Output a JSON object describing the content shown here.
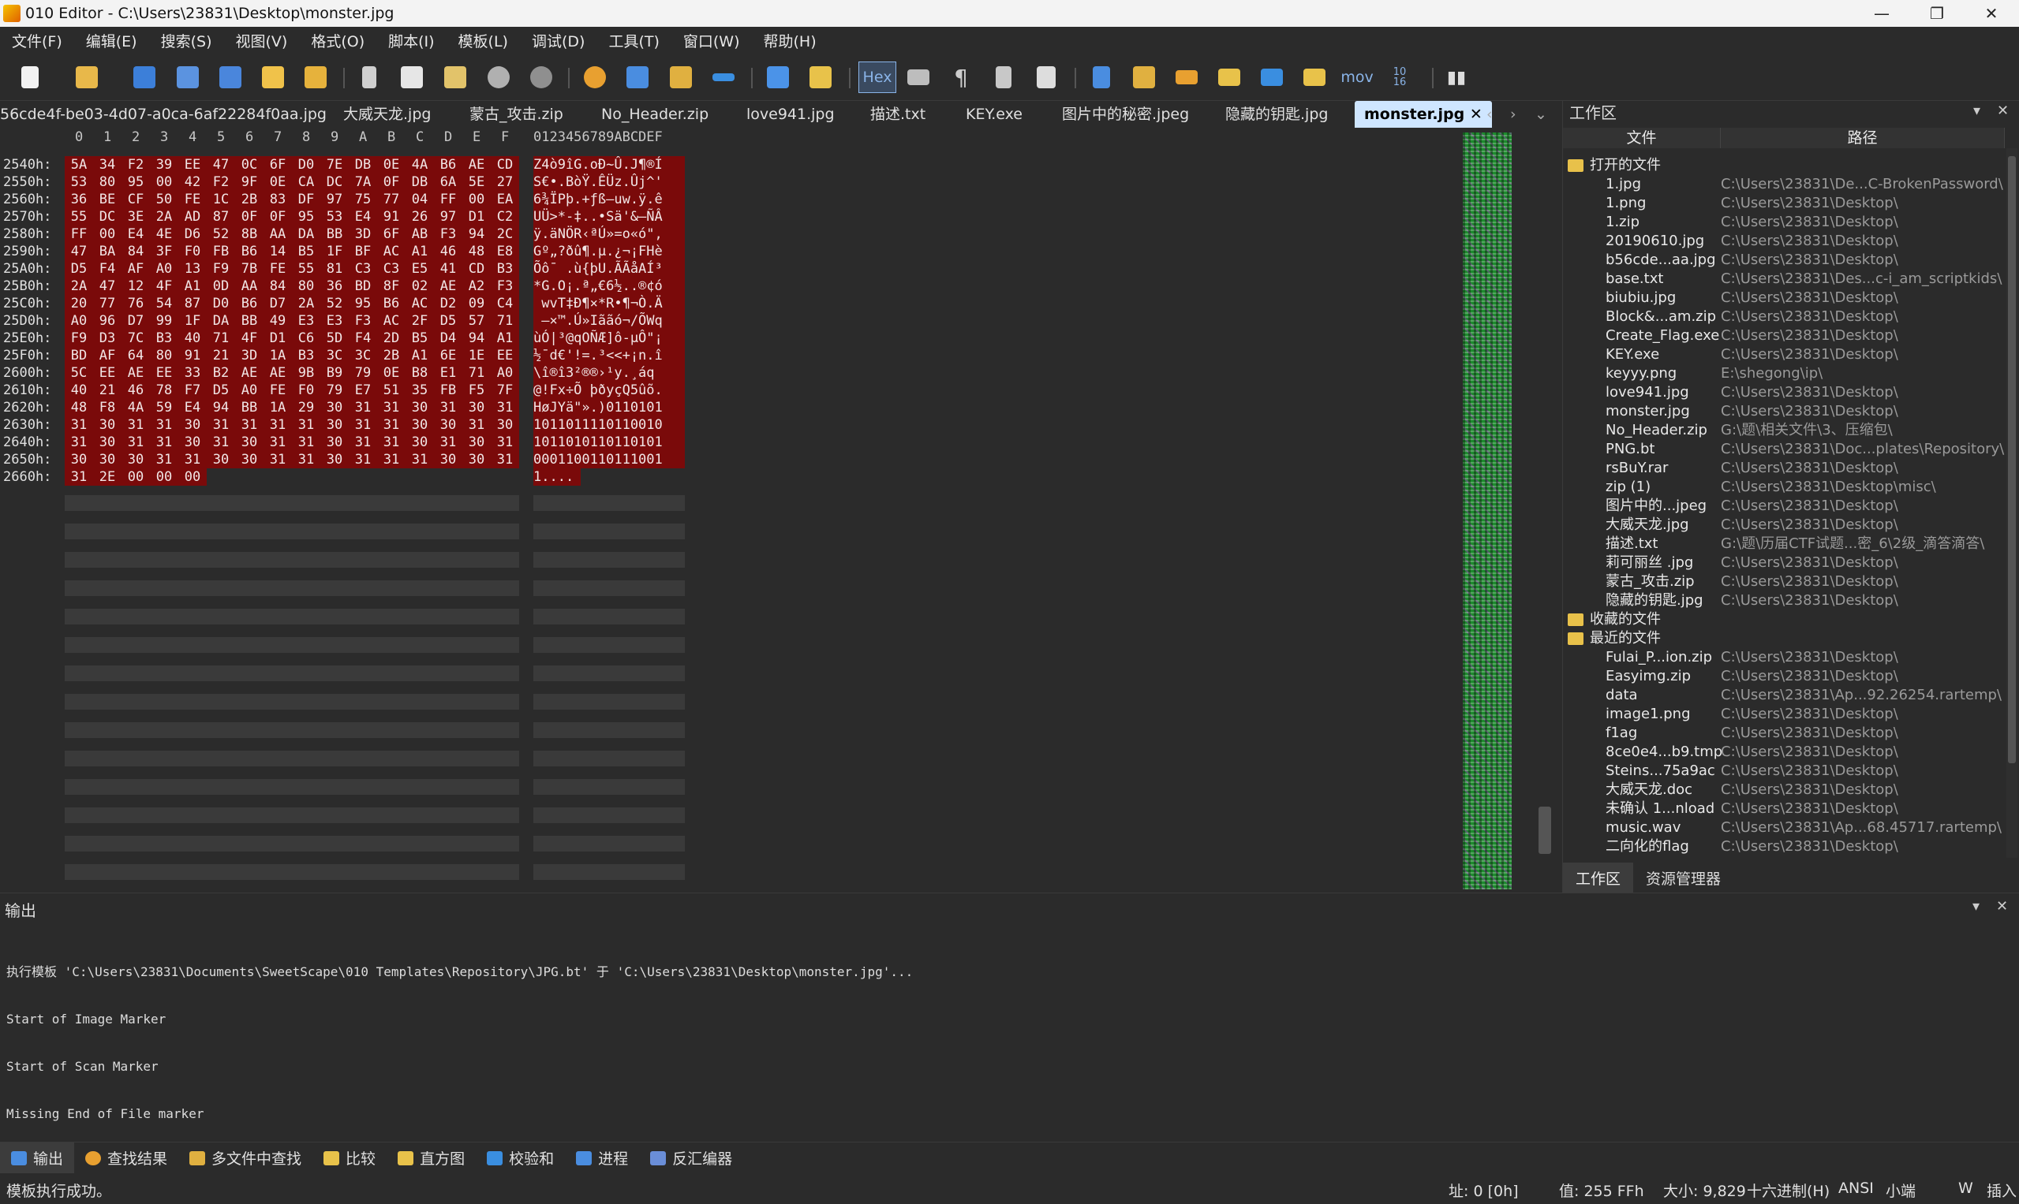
{
  "window": {
    "title": "010 Editor - C:\\Users\\23831\\Desktop\\monster.jpg",
    "min": "—",
    "max": "❐",
    "close": "✕"
  },
  "menu": [
    "文件(F)",
    "编辑(E)",
    "搜索(S)",
    "视图(V)",
    "格式(O)",
    "脚本(I)",
    "模板(L)",
    "调试(D)",
    "工具(T)",
    "窗口(W)",
    "帮助(H)"
  ],
  "toolbar": {
    "hex_label": "Hex",
    "mov_label": "mov",
    "num_label": "10\n16"
  },
  "tabs": [
    "56cde4f-be03-4d07-a0ca-6af22284f0aa.jpg",
    "大威天龙.jpg",
    "蒙古_攻击.zip",
    "No_Header.zip",
    "love941.jpg",
    "描述.txt",
    "KEY.exe",
    "图片中的秘密.jpeg",
    "隐藏的钥匙.jpg",
    "monster.jpg"
  ],
  "active_tab_close": "✕",
  "hex": {
    "col_headers": [
      "0",
      "1",
      "2",
      "3",
      "4",
      "5",
      "6",
      "7",
      "8",
      "9",
      "A",
      "B",
      "C",
      "D",
      "E",
      "F"
    ],
    "ascii_header": "0123456789ABCDEF",
    "rows": [
      {
        "addr": "2540h:",
        "bytes": [
          "5A",
          "34",
          "F2",
          "39",
          "EE",
          "47",
          "0C",
          "6F",
          "D0",
          "7E",
          "DB",
          "0E",
          "4A",
          "B6",
          "AE",
          "CD"
        ],
        "ascii": "Z4ò9îG.oÐ~Û.J¶®Í"
      },
      {
        "addr": "2550h:",
        "bytes": [
          "53",
          "80",
          "95",
          "00",
          "42",
          "F2",
          "9F",
          "0E",
          "CA",
          "DC",
          "7A",
          "0F",
          "DB",
          "6A",
          "5E",
          "27"
        ],
        "ascii": "S€•.BòŸ.ÊÜz.Ûj^'"
      },
      {
        "addr": "2560h:",
        "bytes": [
          "36",
          "BE",
          "CF",
          "50",
          "FE",
          "1C",
          "2B",
          "83",
          "DF",
          "97",
          "75",
          "77",
          "04",
          "FF",
          "00",
          "EA"
        ],
        "ascii": "6¾ÏPþ.+ƒß—uw.ÿ.ê"
      },
      {
        "addr": "2570h:",
        "bytes": [
          "55",
          "DC",
          "3E",
          "2A",
          "AD",
          "87",
          "0F",
          "0F",
          "95",
          "53",
          "E4",
          "91",
          "26",
          "97",
          "D1",
          "C2"
        ],
        "ascii": "UÜ>*-‡..•Sä'&—ÑÂ"
      },
      {
        "addr": "2580h:",
        "bytes": [
          "FF",
          "00",
          "E4",
          "4E",
          "D6",
          "52",
          "8B",
          "AA",
          "DA",
          "BB",
          "3D",
          "6F",
          "AB",
          "F3",
          "94",
          "2C"
        ],
        "ascii": "ÿ.äNÖR‹ªÚ»=o«ó\","
      },
      {
        "addr": "2590h:",
        "bytes": [
          "47",
          "BA",
          "84",
          "3F",
          "F0",
          "FB",
          "B6",
          "14",
          "B5",
          "1F",
          "BF",
          "AC",
          "A1",
          "46",
          "48",
          "E8"
        ],
        "ascii": "Gº„?ðû¶.µ.¿¬¡FHè"
      },
      {
        "addr": "25A0h:",
        "bytes": [
          "D5",
          "F4",
          "AF",
          "A0",
          "13",
          "F9",
          "7B",
          "FE",
          "55",
          "81",
          "C3",
          "C3",
          "E5",
          "41",
          "CD",
          "B3"
        ],
        "ascii": "Õô¯ .ù{þU.ÃÃåAÍ³"
      },
      {
        "addr": "25B0h:",
        "bytes": [
          "2A",
          "47",
          "12",
          "4F",
          "A1",
          "0D",
          "AA",
          "84",
          "80",
          "36",
          "BD",
          "8F",
          "02",
          "AE",
          "A2",
          "F3"
        ],
        "ascii": "*G.O¡.ª„€6½..®¢ó"
      },
      {
        "addr": "25C0h:",
        "bytes": [
          "20",
          "77",
          "76",
          "54",
          "87",
          "D0",
          "B6",
          "D7",
          "2A",
          "52",
          "95",
          "B6",
          "AC",
          "D2",
          "09",
          "C4"
        ],
        "ascii": " wvT‡Ð¶×*R•¶¬Ò.Ä"
      },
      {
        "addr": "25D0h:",
        "bytes": [
          "A0",
          "96",
          "D7",
          "99",
          "1F",
          "DA",
          "BB",
          "49",
          "E3",
          "E3",
          "F3",
          "AC",
          "2F",
          "D5",
          "57",
          "71"
        ],
        "ascii": " –×™.Ú»Iããó¬/ÕWq"
      },
      {
        "addr": "25E0h:",
        "bytes": [
          "F9",
          "D3",
          "7C",
          "B3",
          "40",
          "71",
          "4F",
          "D1",
          "C6",
          "5D",
          "F4",
          "2D",
          "B5",
          "D4",
          "94",
          "A1"
        ],
        "ascii": "ùÓ|³@qOÑÆ]ô-µÔ\"¡"
      },
      {
        "addr": "25F0h:",
        "bytes": [
          "BD",
          "AF",
          "64",
          "80",
          "91",
          "21",
          "3D",
          "1A",
          "B3",
          "3C",
          "3C",
          "2B",
          "A1",
          "6E",
          "1E",
          "EE"
        ],
        "ascii": "½¯d€'!=.³<<+¡n.î"
      },
      {
        "addr": "2600h:",
        "bytes": [
          "5C",
          "EE",
          "AE",
          "EE",
          "33",
          "B2",
          "AE",
          "AE",
          "9B",
          "B9",
          "79",
          "0E",
          "B8",
          "E1",
          "71",
          "A0"
        ],
        "ascii": "\\î®î3²®®›¹y.¸áq "
      },
      {
        "addr": "2610h:",
        "bytes": [
          "40",
          "21",
          "46",
          "78",
          "F7",
          "D5",
          "A0",
          "FE",
          "F0",
          "79",
          "E7",
          "51",
          "35",
          "FB",
          "F5",
          "7F"
        ],
        "ascii": "@!Fx÷Õ þðyçQ5ûõ."
      },
      {
        "addr": "2620h:",
        "bytes": [
          "48",
          "F8",
          "4A",
          "59",
          "E4",
          "94",
          "BB",
          "1A",
          "29",
          "30",
          "31",
          "31",
          "30",
          "31",
          "30",
          "31"
        ],
        "ascii": "HøJYä\"».)0110101"
      },
      {
        "addr": "2630h:",
        "bytes": [
          "31",
          "30",
          "31",
          "31",
          "30",
          "31",
          "31",
          "31",
          "31",
          "30",
          "31",
          "31",
          "30",
          "30",
          "31",
          "30"
        ],
        "ascii": "1011011110110010"
      },
      {
        "addr": "2640h:",
        "bytes": [
          "31",
          "30",
          "31",
          "31",
          "30",
          "31",
          "30",
          "31",
          "31",
          "30",
          "31",
          "31",
          "30",
          "31",
          "30",
          "31"
        ],
        "ascii": "1011010110110101"
      },
      {
        "addr": "2650h:",
        "bytes": [
          "30",
          "30",
          "30",
          "31",
          "31",
          "30",
          "30",
          "31",
          "31",
          "30",
          "31",
          "31",
          "31",
          "30",
          "30",
          "31"
        ],
        "ascii": "0001100110111001"
      },
      {
        "addr": "2660h:",
        "bytes": [
          "31",
          "2E",
          "00",
          "00",
          "00"
        ],
        "ascii": "1...."
      }
    ]
  },
  "workspace": {
    "title": "工作区",
    "col_file": "文件",
    "col_path": "路径",
    "groups": [
      {
        "label": "打开的文件",
        "items": [
          {
            "name": "1.jpg",
            "path": "C:\\Users\\23831\\De...C-BrokenPassword\\"
          },
          {
            "name": "1.png",
            "path": "C:\\Users\\23831\\Desktop\\"
          },
          {
            "name": "1.zip",
            "path": "C:\\Users\\23831\\Desktop\\"
          },
          {
            "name": "20190610.jpg",
            "path": "C:\\Users\\23831\\Desktop\\"
          },
          {
            "name": "b56cde...aa.jpg",
            "path": "C:\\Users\\23831\\Desktop\\"
          },
          {
            "name": "base.txt",
            "path": "C:\\Users\\23831\\Des...c-i_am_scriptkids\\"
          },
          {
            "name": "biubiu.jpg",
            "path": "C:\\Users\\23831\\Desktop\\"
          },
          {
            "name": "Block&...am.zip",
            "path": "C:\\Users\\23831\\Desktop\\"
          },
          {
            "name": "Create_Flag.exe",
            "path": "C:\\Users\\23831\\Desktop\\"
          },
          {
            "name": "KEY.exe",
            "path": "C:\\Users\\23831\\Desktop\\"
          },
          {
            "name": "keyyy.png",
            "path": "E:\\shegong\\ip\\"
          },
          {
            "name": "love941.jpg",
            "path": "C:\\Users\\23831\\Desktop\\"
          },
          {
            "name": "monster.jpg",
            "path": "C:\\Users\\23831\\Desktop\\"
          },
          {
            "name": "No_Header.zip",
            "path": "G:\\题\\相关文件\\3、压缩包\\"
          },
          {
            "name": "PNG.bt",
            "path": "C:\\Users\\23831\\Doc...plates\\Repository\\"
          },
          {
            "name": "rsBuY.rar",
            "path": "C:\\Users\\23831\\Desktop\\"
          },
          {
            "name": "zip (1)",
            "path": "C:\\Users\\23831\\Desktop\\misc\\"
          },
          {
            "name": "图片中的...jpeg",
            "path": "C:\\Users\\23831\\Desktop\\"
          },
          {
            "name": "大威天龙.jpg",
            "path": "C:\\Users\\23831\\Desktop\\"
          },
          {
            "name": "描述.txt",
            "path": "G:\\题\\历届CTF试题...密_6\\2级_滴答滴答\\"
          },
          {
            "name": "莉可丽丝 .jpg",
            "path": "C:\\Users\\23831\\Desktop\\"
          },
          {
            "name": "蒙古_攻击.zip",
            "path": "C:\\Users\\23831\\Desktop\\"
          },
          {
            "name": "隐藏的钥匙.jpg",
            "path": "C:\\Users\\23831\\Desktop\\"
          }
        ]
      },
      {
        "label": "收藏的文件",
        "items": []
      },
      {
        "label": "最近的文件",
        "items": [
          {
            "name": "Fulai_P...ion.zip",
            "path": "C:\\Users\\23831\\Desktop\\"
          },
          {
            "name": "Easyimg.zip",
            "path": "C:\\Users\\23831\\Desktop\\"
          },
          {
            "name": "data",
            "path": "C:\\Users\\23831\\Ap...92.26254.rartemp\\"
          },
          {
            "name": "image1.png",
            "path": "C:\\Users\\23831\\Desktop\\"
          },
          {
            "name": "f1ag",
            "path": "C:\\Users\\23831\\Desktop\\"
          },
          {
            "name": "8ce0e4...b9.tmp",
            "path": "C:\\Users\\23831\\Desktop\\"
          },
          {
            "name": "Steins...75a9ac",
            "path": "C:\\Users\\23831\\Desktop\\"
          },
          {
            "name": "大威天龙.doc",
            "path": "C:\\Users\\23831\\Desktop\\"
          },
          {
            "name": "未确认 1...nload",
            "path": "C:\\Users\\23831\\Desktop\\"
          },
          {
            "name": "music.wav",
            "path": "C:\\Users\\23831\\Ap...68.45717.rartemp\\"
          },
          {
            "name": "二向化的flag",
            "path": "C:\\Users\\23831\\Desktop\\"
          }
        ]
      }
    ],
    "bottom_tabs": [
      "工作区",
      "资源管理器"
    ]
  },
  "output": {
    "title": "输出",
    "lines": [
      "执行模板 'C:\\Users\\23831\\Documents\\SweetScape\\010 Templates\\Repository\\JPG.bt' 于 'C:\\Users\\23831\\Desktop\\monster.jpg'...",
      "Start of Image Marker",
      "Start of Scan Marker",
      "Missing End of File marker"
    ]
  },
  "bottom_tabs": [
    "输出",
    "查找结果",
    "多文件中查找",
    "比较",
    "直方图",
    "校验和",
    "进程",
    "反汇编器"
  ],
  "status": {
    "message": "模板执行成功。",
    "address": "址: 0 [0h]",
    "value": "值: 255 FFh",
    "size": "大小: 9,829",
    "mode": "十六进制(H)",
    "encoding": "ANSI",
    "endian": "小端",
    "w": "W",
    "insert": "插入"
  }
}
